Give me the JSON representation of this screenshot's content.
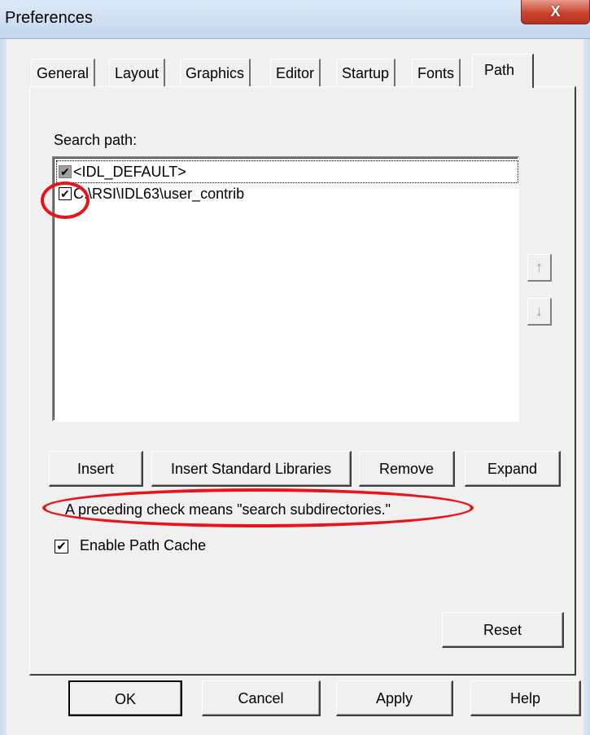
{
  "window": {
    "title": "Preferences",
    "close_glyph": "X"
  },
  "tabs": [
    {
      "label": "General"
    },
    {
      "label": "Layout"
    },
    {
      "label": "Graphics"
    },
    {
      "label": "Editor"
    },
    {
      "label": "Startup"
    },
    {
      "label": "Fonts"
    },
    {
      "label": "Path",
      "active": true
    }
  ],
  "path_tab": {
    "search_path_label": "Search path:",
    "paths": [
      {
        "text": "<IDL_DEFAULT>",
        "checked": true,
        "disabled": true
      },
      {
        "text": "C:\\RSI\\IDL63\\user_contrib",
        "checked": true,
        "disabled": false
      }
    ],
    "move_up_glyph": "↑",
    "move_down_glyph": "↓",
    "buttons": {
      "insert": "Insert",
      "insert_standard": "Insert Standard Libraries",
      "remove": "Remove",
      "expand": "Expand"
    },
    "hint": "A preceding check means \"search subdirectories.\"",
    "enable_cache_label": "Enable Path Cache",
    "enable_cache_checked": true,
    "reset": "Reset"
  },
  "dialog_buttons": {
    "ok": "OK",
    "cancel": "Cancel",
    "apply": "Apply",
    "help": "Help"
  },
  "colors": {
    "annotation": "#e8141a",
    "close_button": "#c9442f"
  }
}
